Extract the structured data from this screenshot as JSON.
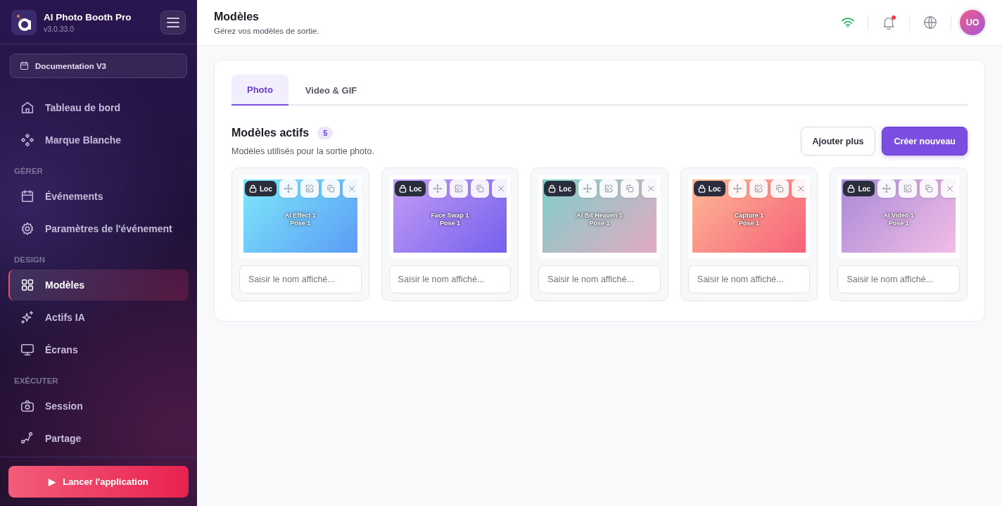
{
  "app": {
    "name": "AI Photo Booth Pro",
    "version": "v3.0.33.0"
  },
  "event_selector": {
    "label": "Documentation V3"
  },
  "sidebar": {
    "sections": [
      {
        "items": [
          {
            "label": "Tableau de bord",
            "selected": false
          },
          {
            "label": "Marque Blanche",
            "selected": false
          }
        ]
      },
      {
        "heading": "GÉRER",
        "items": [
          {
            "label": "Événements",
            "selected": false
          },
          {
            "label": "Paramètres de l'événement",
            "selected": false
          }
        ]
      },
      {
        "heading": "DESIGN",
        "items": [
          {
            "label": "Modèles",
            "selected": true
          },
          {
            "label": "Actifs IA",
            "selected": false
          },
          {
            "label": "Écrans",
            "selected": false
          }
        ]
      },
      {
        "heading": "EXÉCUTER",
        "items": [
          {
            "label": "Session",
            "selected": false
          },
          {
            "label": "Partage",
            "selected": false
          }
        ]
      }
    ]
  },
  "launch_button": {
    "label": "Lancer l'application",
    "icon": "▶"
  },
  "header": {
    "title": "Modèles",
    "subtitle": "Gérez vos modèles de sortie.",
    "avatar": "UO",
    "notification_unread": true
  },
  "tabs": [
    {
      "label": "Photo",
      "selected": true
    },
    {
      "label": "Video & GIF",
      "selected": false
    }
  ],
  "section": {
    "title": "Modèles actifs",
    "count": "5",
    "description": "Modèles utilisés pour la sortie photo.",
    "buttons": [
      {
        "label": "Ajouter plus",
        "kind": "secondary"
      },
      {
        "label": "Créer nouveau",
        "kind": "primary"
      }
    ]
  },
  "templates": [
    {
      "badge": "Loc",
      "locked": true,
      "line1": "AI Effect 1",
      "line2": "Pose 1",
      "placeholder": "Saisir le nom affiché..."
    },
    {
      "badge": "Loc",
      "locked": true,
      "line1": "Face Swap 1",
      "line2": "Pose 1",
      "placeholder": "Saisir le nom affiché..."
    },
    {
      "badge": "Loc",
      "locked": true,
      "line1": "AI Bit Heaven 1",
      "line2": "Pose 1",
      "placeholder": "Saisir le nom affiché..."
    },
    {
      "badge": "Loc",
      "locked": true,
      "line1": "Capture 1",
      "line2": "Pose 1",
      "placeholder": "Saisir le nom affiché..."
    },
    {
      "badge": "Loc",
      "locked": true,
      "line1": "AI Video 1",
      "line2": "Pose 1",
      "placeholder": "Saisir le nom affiché..."
    }
  ]
}
